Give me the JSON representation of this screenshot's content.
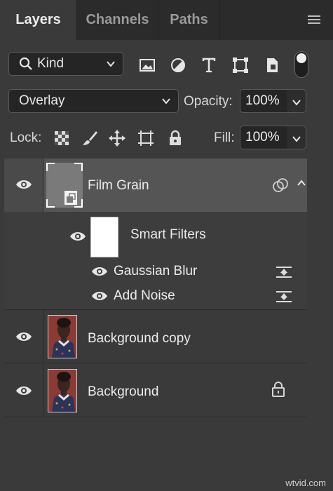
{
  "tabs": [
    {
      "label": "Layers"
    },
    {
      "label": "Channels"
    },
    {
      "label": "Paths"
    }
  ],
  "filter": {
    "kind_label": "Kind",
    "icons": [
      "image-filter-icon",
      "adjustment-filter-icon",
      "type-filter-icon",
      "shape-filter-icon",
      "smart-object-filter-icon"
    ]
  },
  "blend": {
    "mode": "Overlay",
    "opacity_label": "Opacity:",
    "opacity_value": "100%"
  },
  "lock": {
    "label": "Lock:",
    "icons": [
      "lock-transparent-pixels-icon",
      "lock-image-pixels-icon",
      "lock-position-icon",
      "lock-artboard-icon",
      "lock-all-icon"
    ],
    "fill_label": "Fill:",
    "fill_value": "100%"
  },
  "layers": [
    {
      "name": "Film Grain",
      "selected": true,
      "type": "smart-object"
    },
    {
      "name": "Background copy",
      "type": "image"
    },
    {
      "name": "Background",
      "type": "image",
      "locked": true
    }
  ],
  "smart_filters": {
    "label": "Smart Filters",
    "items": [
      {
        "name": "Gaussian Blur"
      },
      {
        "name": "Add Noise"
      }
    ]
  },
  "watermark": "wtvid.com",
  "colors": {
    "panel_bg": "#3a3a3a",
    "tab_bar_bg": "#2b2b2b",
    "selected_layer_bg": "#555555"
  }
}
